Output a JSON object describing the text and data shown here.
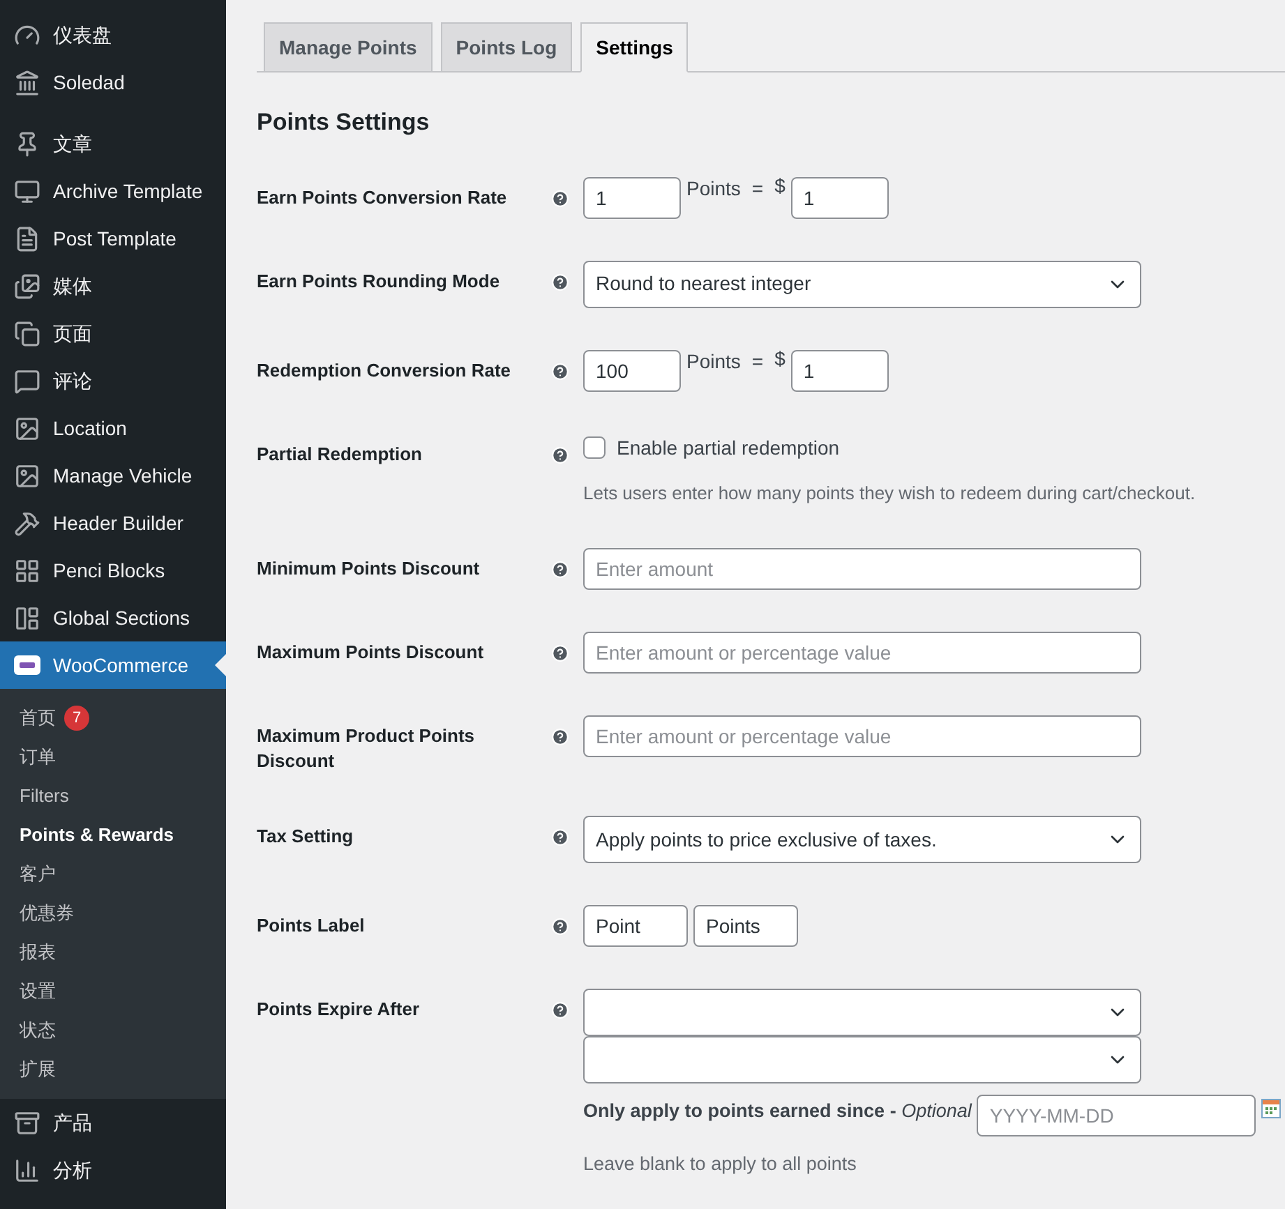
{
  "sidebar": {
    "items": [
      {
        "label": "仪表盘",
        "selected": false
      },
      {
        "label": "Soledad",
        "selected": false
      },
      {
        "label": "文章",
        "selected": false
      },
      {
        "label": "Archive Template",
        "selected": false
      },
      {
        "label": "Post Template",
        "selected": false
      },
      {
        "label": "媒体",
        "selected": false
      },
      {
        "label": "页面",
        "selected": false
      },
      {
        "label": "评论",
        "selected": false
      },
      {
        "label": "Location",
        "selected": false
      },
      {
        "label": "Manage Vehicle",
        "selected": false
      },
      {
        "label": "Header Builder",
        "selected": false
      },
      {
        "label": "Penci Blocks",
        "selected": false
      },
      {
        "label": "Global Sections",
        "selected": false
      },
      {
        "label": "WooCommerce",
        "selected": true,
        "children": [
          {
            "label": "首页",
            "badge": "7",
            "selected": false
          },
          {
            "label": "订单",
            "selected": false
          },
          {
            "label": "Filters",
            "selected": false
          },
          {
            "label": "Points & Rewards",
            "selected": true
          },
          {
            "label": "客户",
            "selected": false
          },
          {
            "label": "优惠券",
            "selected": false
          },
          {
            "label": "报表",
            "selected": false
          },
          {
            "label": "设置",
            "selected": false
          },
          {
            "label": "状态",
            "selected": false
          },
          {
            "label": "扩展",
            "selected": false
          }
        ]
      },
      {
        "label": "产品",
        "selected": false
      },
      {
        "label": "分析",
        "selected": false
      }
    ]
  },
  "tabs": [
    {
      "label": "Manage Points",
      "selected": false
    },
    {
      "label": "Points Log",
      "selected": false
    },
    {
      "label": "Settings",
      "selected": true
    }
  ],
  "section_title": "Points Settings",
  "fields": [
    {
      "kind": "rate",
      "label": "Earn Points Conversion Rate",
      "points": "1",
      "unit": "Points",
      "equals": "=",
      "currency": "$",
      "amount": "1"
    },
    {
      "kind": "select",
      "label": "Earn Points Rounding Mode",
      "value": "Round to nearest integer"
    },
    {
      "kind": "rate",
      "label": "Redemption Conversion Rate",
      "points": "100",
      "unit": "Points",
      "equals": "=",
      "currency": "$",
      "amount": "1"
    },
    {
      "kind": "checkbox",
      "label": "Partial Redemption",
      "option": "Enable partial redemption",
      "checked": false,
      "description": "Lets users enter how many points they wish to redeem during cart/checkout."
    },
    {
      "kind": "text",
      "label": "Minimum Points Discount",
      "placeholder": "Enter amount"
    },
    {
      "kind": "text",
      "label": "Maximum Points Discount",
      "placeholder": "Enter amount or percentage value"
    },
    {
      "kind": "text",
      "label": "Maximum Product Points Discount",
      "placeholder": "Enter amount or percentage value"
    },
    {
      "kind": "select",
      "label": "Tax Setting",
      "value": "Apply points to price exclusive of taxes."
    },
    {
      "kind": "pair",
      "label": "Points Label",
      "singular": "Point",
      "plural": "Points"
    },
    {
      "kind": "expire",
      "label": "Points Expire After",
      "since_label": "Only apply to points earned since",
      "separator": "-",
      "optional": "Optional",
      "date_placeholder": "YYYY-MM-DD",
      "description": "Leave blank to apply to all points"
    }
  ]
}
